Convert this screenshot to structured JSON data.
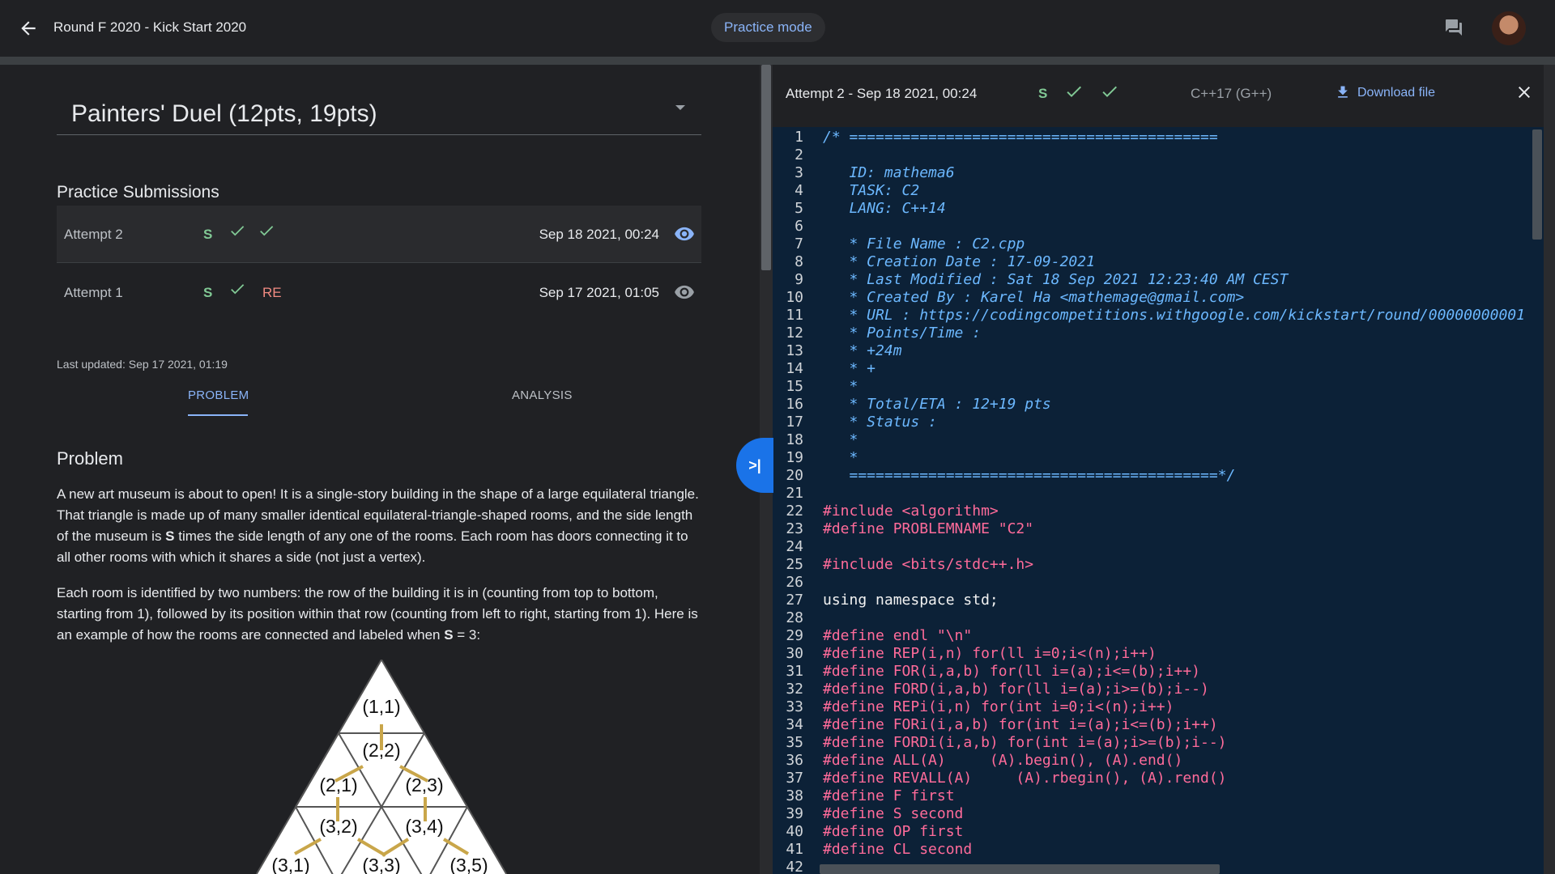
{
  "header": {
    "title": "Round F 2020 - Kick Start 2020",
    "mode": "Practice mode",
    "back_icon": "arrow-left-icon",
    "chat_icon": "feedback-chat-icon"
  },
  "problem_selector": {
    "title": "Painters' Duel (12pts, 19pts)"
  },
  "submissions": {
    "heading": "Practice Submissions",
    "rows": [
      {
        "label": "Attempt 2",
        "badge": "S",
        "results": [
          "pass",
          "pass"
        ],
        "date": "Sep 18 2021, 00:24",
        "selected": true
      },
      {
        "label": "Attempt 1",
        "badge": "S",
        "results": [
          "pass",
          "RE"
        ],
        "date": "Sep 17 2021, 01:05",
        "selected": false
      }
    ],
    "last_updated": "Last updated: Sep 17 2021, 01:19"
  },
  "tabs": {
    "problem": "PROBLEM",
    "analysis": "ANALYSIS"
  },
  "problem": {
    "heading": "Problem",
    "para1_parts": [
      "A new art museum is about to open! It is a single-story building in the shape of a large equilateral triangle. That triangle is made up of many smaller identical equilateral-triangle-shaped rooms, and the side length of the museum is ",
      "S",
      " times the side length of any one of the rooms. Each room has doors connecting it to all other rooms with which it shares a side (not just a vertex)."
    ],
    "para2_parts": [
      "Each room is identified by two numbers: the row of the building it is in (counting from top to bottom, starting from 1), followed by its position within that row (counting from left to right, starting from 1). Here is an example of how the rooms are connected and labeled when ",
      "S",
      " = 3:"
    ],
    "figure_labels": [
      "(1,1)",
      "(2,2)",
      "(2,1)",
      "(2,3)",
      "(3,2)",
      "(3,4)",
      "(3,1)",
      "(3,3)",
      "(3,5)"
    ]
  },
  "viewer": {
    "title": "Attempt 2 - Sep 18 2021, 00:24",
    "badge": "S",
    "language": "C++17 (G++)",
    "download": "Download file",
    "collapse_label": ">|"
  },
  "code": {
    "lines": [
      {
        "n": "1",
        "t": "/* ==========================================",
        "k": "comment"
      },
      {
        "n": "2",
        "t": "",
        "k": "comment"
      },
      {
        "n": "3",
        "t": "   ID: mathema6",
        "k": "comment"
      },
      {
        "n": "4",
        "t": "   TASK: C2",
        "k": "comment"
      },
      {
        "n": "5",
        "t": "   LANG: C++14",
        "k": "comment"
      },
      {
        "n": "6",
        "t": "",
        "k": "comment"
      },
      {
        "n": "7",
        "t": "   * File Name : C2.cpp",
        "k": "comment"
      },
      {
        "n": "8",
        "t": "   * Creation Date : 17-09-2021",
        "k": "comment"
      },
      {
        "n": "9",
        "t": "   * Last Modified : Sat 18 Sep 2021 12:23:40 AM CEST",
        "k": "comment"
      },
      {
        "n": "10",
        "t": "   * Created By : Karel Ha <mathemage@gmail.com>",
        "k": "comment"
      },
      {
        "n": "11",
        "t": "   * URL : https://codingcompetitions.withgoogle.com/kickstart/round/00000000001",
        "k": "comment"
      },
      {
        "n": "12",
        "t": "   * Points/Time :",
        "k": "comment"
      },
      {
        "n": "13",
        "t": "   * +24m",
        "k": "comment"
      },
      {
        "n": "14",
        "t": "   * +",
        "k": "comment"
      },
      {
        "n": "15",
        "t": "   *",
        "k": "comment"
      },
      {
        "n": "16",
        "t": "   * Total/ETA : 12+19 pts",
        "k": "comment"
      },
      {
        "n": "17",
        "t": "   * Status :",
        "k": "comment"
      },
      {
        "n": "18",
        "t": "   *",
        "k": "comment"
      },
      {
        "n": "19",
        "t": "   *",
        "k": "comment"
      },
      {
        "n": "20",
        "t": "   ==========================================*/",
        "k": "comment"
      },
      {
        "n": "21",
        "t": "",
        "k": "plain"
      },
      {
        "n": "22",
        "t": "#include <algorithm>",
        "k": "pre"
      },
      {
        "n": "23",
        "t": "#define PROBLEMNAME \"C2\"",
        "k": "pre"
      },
      {
        "n": "24",
        "t": "",
        "k": "plain"
      },
      {
        "n": "25",
        "t": "#include <bits/stdc++.h>",
        "k": "pre"
      },
      {
        "n": "26",
        "t": "",
        "k": "plain"
      },
      {
        "n": "27",
        "t": "using namespace std;",
        "k": "plain"
      },
      {
        "n": "28",
        "t": "",
        "k": "plain"
      },
      {
        "n": "29",
        "t": "#define endl \"\\n\"",
        "k": "pre"
      },
      {
        "n": "30",
        "t": "#define REP(i,n) for(ll i=0;i<(n);i++)",
        "k": "pre"
      },
      {
        "n": "31",
        "t": "#define FOR(i,a,b) for(ll i=(a);i<=(b);i++)",
        "k": "pre"
      },
      {
        "n": "32",
        "t": "#define FORD(i,a,b) for(ll i=(a);i>=(b);i--)",
        "k": "pre"
      },
      {
        "n": "33",
        "t": "#define REPi(i,n) for(int i=0;i<(n);i++)",
        "k": "pre"
      },
      {
        "n": "34",
        "t": "#define FORi(i,a,b) for(int i=(a);i<=(b);i++)",
        "k": "pre"
      },
      {
        "n": "35",
        "t": "#define FORDi(i,a,b) for(int i=(a);i>=(b);i--)",
        "k": "pre"
      },
      {
        "n": "36",
        "t": "#define ALL(A)     (A).begin(), (A).end()",
        "k": "pre"
      },
      {
        "n": "37",
        "t": "#define REVALL(A)     (A).rbegin(), (A).rend()",
        "k": "pre"
      },
      {
        "n": "38",
        "t": "#define F first",
        "k": "pre"
      },
      {
        "n": "39",
        "t": "#define S second",
        "k": "pre"
      },
      {
        "n": "40",
        "t": "#define OP first",
        "k": "pre"
      },
      {
        "n": "41",
        "t": "#define CL second",
        "k": "pre"
      },
      {
        "n": "42",
        "t": "",
        "k": "pre"
      }
    ]
  },
  "colors": {
    "accent": "#8ab4f8",
    "pass_green": "#81c995",
    "error_red": "#f28b82",
    "editor_bg": "#0c2137"
  }
}
